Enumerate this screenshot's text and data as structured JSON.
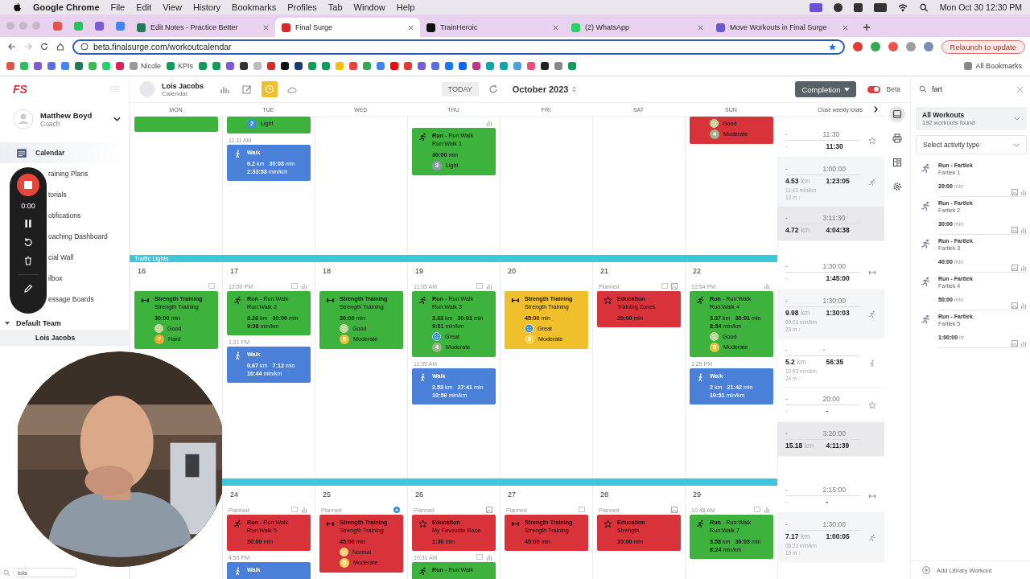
{
  "menubar": {
    "app": "Google Chrome",
    "items": [
      "File",
      "Edit",
      "View",
      "History",
      "Bookmarks",
      "Profiles",
      "Tab",
      "Window",
      "Help"
    ],
    "clock": "Mon Oct 30  12:30 PM"
  },
  "browser": {
    "pinned": [
      {
        "color": "#e0544b"
      },
      {
        "color": "#2dbe60"
      },
      {
        "color": "#7b5cd6"
      },
      {
        "color": "#4285f4"
      }
    ],
    "tabs": [
      {
        "title": "Edit Notes - Practice Better",
        "selected": false,
        "color": "#1f7a5a"
      },
      {
        "title": "Final Surge",
        "selected": true,
        "color": "#d62b2b"
      },
      {
        "title": "TrainHeroic",
        "selected": false,
        "color": "#111111"
      },
      {
        "title": "(2) WhatsApp",
        "selected": false,
        "color": "#25d366"
      },
      {
        "title": "Move Workouts in Final Surge",
        "selected": false,
        "color": "#6a5acd"
      }
    ],
    "url": "beta.finalsurge.com/workoutcalendar",
    "relaunch": "Relaunch to update",
    "bookmarks": [
      {
        "color": "#e0544b"
      },
      {
        "color": "#2dbe60"
      },
      {
        "color": "#7b5cd6"
      },
      {
        "color": "#5b6ee1"
      },
      {
        "color": "#4285f4"
      },
      {
        "color": "#1f7a5a"
      },
      {
        "color": "#3cba54"
      },
      {
        "color": "#25d366"
      },
      {
        "color": "#e01e5a"
      },
      {
        "label": "Nicole",
        "color": "#999999"
      },
      {
        "label": "KPIs",
        "color": "#0f9d58"
      },
      {
        "color": "#0f9d58"
      },
      {
        "color": "#0f9d58"
      },
      {
        "color": "#7b5cd6"
      },
      {
        "color": "#333333"
      },
      {
        "color": "#bbbbbb"
      },
      {
        "color": "#d62b2b"
      },
      {
        "color": "#111111"
      },
      {
        "color": "#1a3a7a"
      },
      {
        "color": "#0f9d58"
      },
      {
        "color": "#0f9d58"
      },
      {
        "color": "#fbbc05"
      },
      {
        "color": "#ea4335"
      },
      {
        "color": "#34a853"
      },
      {
        "color": "#4285f4"
      },
      {
        "color": "#ff0000"
      },
      {
        "color": "#e53935"
      },
      {
        "color": "#7b5cd6"
      },
      {
        "color": "#5b6ee1"
      },
      {
        "color": "#1877f2"
      },
      {
        "color": "#0866ff"
      },
      {
        "color": "#c13584"
      },
      {
        "color": "#0ea5a5"
      },
      {
        "color": "#0ea5a5"
      },
      {
        "color": "#4aa3df"
      },
      {
        "color": "#e94e77"
      },
      {
        "color": "#222222"
      },
      {
        "color": "#888888"
      },
      {
        "color": "#0f9d58"
      }
    ],
    "all_bookmarks": "All Bookmarks"
  },
  "sidebar": {
    "logo": "FS",
    "user": {
      "name": "Matthew Boyd",
      "role": "Coach"
    },
    "nav": [
      {
        "label": "Calendar",
        "selected": true,
        "kind": "calendar"
      },
      {
        "label": "raining Plans",
        "selected": false
      },
      {
        "label": "torials",
        "selected": false
      },
      {
        "label": "otifications",
        "selected": false
      },
      {
        "label": "oaching Dashboard",
        "selected": false
      },
      {
        "label": "cial Wall",
        "selected": false
      },
      {
        "label": "ilbox",
        "selected": false
      },
      {
        "label": "essage Boards",
        "selected": false
      }
    ],
    "team": {
      "name": "Default Team",
      "expanded": true
    },
    "athletes": [
      {
        "name": "Lois Jacobs",
        "selected": true
      }
    ],
    "search": {
      "value": "lois"
    }
  },
  "recorder": {
    "time": "0:00"
  },
  "toolbar": {
    "athlete": {
      "name": "Lois Jacobs",
      "sub": "Calendar"
    },
    "views": [
      {
        "kind": "chart",
        "selected": false
      },
      {
        "kind": "edit",
        "selected": false
      },
      {
        "kind": "clock",
        "selected": true
      },
      {
        "kind": "weather",
        "selected": false
      }
    ],
    "today": "TODAY",
    "month": "October 2023",
    "completion": "Completion",
    "beta": {
      "label": "Beta",
      "on": true
    }
  },
  "days": [
    "MON",
    "TUE",
    "WED",
    "THU",
    "FRI",
    "SAT",
    "SUN"
  ],
  "totals_toggle": "Close weekly totals",
  "weeks": [
    {
      "cells": [
        {
          "entries": [
            {
              "kind": "partial",
              "color": "#3db33d"
            }
          ]
        },
        {
          "entries": [
            {
              "kind": "partial",
              "color": "#3db33d",
              "effort": {
                "value": "2",
                "label": "Light",
                "color": "#3a8fd6"
              }
            },
            {
              "time": "11:11 AM",
              "kind": "walk",
              "color": "#4a80d8",
              "title": "Walk",
              "stats": [
                [
                  "**0.2** km",
                  "**30:03** min"
                ],
                [
                  "**2:33:53** min/km"
                ]
              ]
            }
          ]
        },
        {},
        {
          "entries": [
            {
              "chart": true,
              "kind": "run",
              "color": "#3db33d",
              "title": "**Run** - Run:Walk",
              "subtitle": "Run:Walk 1",
              "stats": [
                [
                  "**30:00** min"
                ]
              ],
              "effort": {
                "value": "3",
                "label": "Light",
                "color": "#8f9aa6"
              }
            }
          ]
        },
        {},
        {},
        {
          "entries": [
            {
              "kind": "partial",
              "color": "#d8323a",
              "feel": {
                "label": "Good",
                "color": "#b8d88a"
              },
              "effort": {
                "value": "4",
                "label": "Moderate",
                "color": "#9db38a"
              }
            }
          ]
        }
      ],
      "totals": [
        {
          "kind": "event",
          "planned": [
            "-",
            "11:30"
          ],
          "actual": [
            "-",
            "11:30"
          ]
        },
        {
          "kind": "run",
          "planned": [
            "-",
            "1:00:00"
          ],
          "actual": [
            "**4.53** km",
            "1:23:05"
          ],
          "pace": "11:43 min/km",
          "elev": "12 m ↑"
        },
        {
          "kind": "total",
          "planned": [
            "-",
            "3:11:30"
          ],
          "actual": [
            "**4.72** km",
            "4:04:38"
          ]
        }
      ]
    },
    {
      "label": "Traffic Lights",
      "cells": [
        {
          "date": "16",
          "entries": [
            {
              "note": true,
              "kind": "strength",
              "color": "#3db33d",
              "title": "Strength Training",
              "subtitle": "Strength Training",
              "stats": [
                [
                  "**30:00** min"
                ]
              ],
              "feel": {
                "label": "Good",
                "color": "#b8d88a"
              },
              "effort": {
                "value": "7",
                "label": "Hard",
                "color": "#f0a830"
              }
            }
          ]
        },
        {
          "date": "17",
          "entries": [
            {
              "time": "12:50 PM",
              "note": true,
              "chart": true,
              "kind": "run",
              "color": "#3db33d",
              "title": "**Run** - Run:Walk",
              "subtitle": "Run:Walk 2",
              "stats": [
                [
                  "**3.28** km",
                  "**30:00** min"
                ],
                [
                  "**9:08** min/km"
                ]
              ]
            },
            {
              "time": "1:21 PM",
              "kind": "walk",
              "color": "#4a80d8",
              "title": "Walk",
              "stats": [
                [
                  "**0.67** km",
                  "**7:12** min"
                ],
                [
                  "**10:44** min/km"
                ]
              ]
            }
          ]
        },
        {
          "date": "18",
          "entries": [
            {
              "kind": "strength",
              "color": "#3db33d",
              "title": "Strength Training",
              "subtitle": "Strength Training",
              "stats": [
                [
                  "**30:00** min"
                ]
              ],
              "feel": {
                "label": "Good",
                "color": "#b8d88a"
              },
              "effort": {
                "value": "5",
                "label": "Moderate",
                "color": "#e8c440"
              }
            }
          ]
        },
        {
          "date": "19",
          "entries": [
            {
              "time": "11:05 AM",
              "note": true,
              "chart": true,
              "kind": "run",
              "color": "#3db33d",
              "title": "**Run** - Run:Walk",
              "subtitle": "Run:Walk 3",
              "stats": [
                [
                  "**3.33** km",
                  "**30:01** min"
                ],
                [
                  "**9:01** min/km"
                ]
              ],
              "feel": {
                "label": "Great",
                "color": "#3a8fd6"
              },
              "effort": {
                "value": "4",
                "label": "Moderate",
                "color": "#9db38a"
              }
            },
            {
              "time": "11:35 AM",
              "kind": "walk",
              "color": "#4a80d8",
              "title": "Walk",
              "stats": [
                [
                  "**2.53** km",
                  "**27:41** min"
                ],
                [
                  "**10:56** min/km"
                ]
              ]
            }
          ]
        },
        {
          "date": "20",
          "entries": [
            {
              "kind": "strength",
              "color": "#efbf2c",
              "title": "Strength Training",
              "subtitle": "Strength Training",
              "stats": [
                [
                  "**45:00** min"
                ]
              ],
              "feel": {
                "label": "Great",
                "color": "#3a8fd6"
              },
              "effort": {
                "value": "5",
                "label": "Moderate",
                "color": "#f3d35a"
              }
            }
          ]
        },
        {
          "date": "21",
          "entries": [
            {
              "time": "Planned",
              "note": true,
              "image": true,
              "kind": "education",
              "color": "#d8323a",
              "title": "Education",
              "subtitle": "Training Zones",
              "stats": [
                [
                  "**20:00** min"
                ]
              ]
            }
          ]
        },
        {
          "date": "22",
          "entries": [
            {
              "time": "12:54 PM",
              "chart": true,
              "kind": "run",
              "color": "#3db33d",
              "title": "**Run** - Run:Walk",
              "subtitle": "Run:Walk 4",
              "stats": [
                [
                  "**3.37** km",
                  "**30:01** min"
                ],
                [
                  "**8:54** min/km"
                ]
              ],
              "feel": {
                "label": "Good",
                "color": "#b8d88a"
              },
              "effort": {
                "value": "5",
                "label": "Moderate",
                "color": "#e8c440"
              }
            },
            {
              "time": "1:25 PM",
              "kind": "walk",
              "color": "#4a80d8",
              "title": "Walk",
              "stats": [
                [
                  "**2** km",
                  "**21:42** min"
                ],
                [
                  "**10:51** min/km"
                ]
              ]
            }
          ]
        }
      ],
      "totals": [
        {
          "kind": "strength",
          "planned": [
            "-",
            "1:30:00"
          ],
          "actual": [
            "-",
            "1:45:00"
          ]
        },
        {
          "kind": "run",
          "planned": [
            "-",
            "1:30:00"
          ],
          "actual": [
            "**9.98** km",
            "1:30:03"
          ],
          "pace": "09:01 min/km",
          "elev": "23 m ↑"
        },
        {
          "kind": "walk",
          "planned": [
            "-",
            "-"
          ],
          "actual": [
            "**5.2** km",
            "56:35"
          ],
          "pace": "10:53 min/km",
          "elev": "24 m ↑"
        },
        {
          "kind": "event",
          "planned": [
            "-",
            "20:00"
          ],
          "actual": [
            "-",
            "-"
          ]
        },
        {
          "kind": "total",
          "planned": [
            "-",
            "3:20:00"
          ],
          "actual": [
            "**15.18** km",
            "4:11:39"
          ]
        }
      ]
    },
    {
      "cells": [
        {},
        {
          "date": "24",
          "entries": [
            {
              "time": "Planned",
              "note": true,
              "chart": true,
              "kind": "run",
              "color": "#d8323a",
              "title": "**Run** - Run:Walk",
              "subtitle": "Run:Walk 5",
              "stats": [
                [
                  "**30:00** min"
                ]
              ]
            },
            {
              "time": "4:55 PM",
              "kind": "walk",
              "color": "#4a80d8",
              "title": "Walk"
            }
          ]
        },
        {
          "date": "25",
          "entries": [
            {
              "time": "Planned",
              "upload": true,
              "kind": "strength",
              "color": "#d8323a",
              "title": "Strength Training",
              "subtitle": "Strength Training",
              "stats": [
                [
                  "**45:00** min"
                ]
              ],
              "feel": {
                "label": "Normal",
                "color": "#f3d35a"
              },
              "effort": {
                "value": "5",
                "label": "Moderate",
                "color": "#f3d35a"
              }
            }
          ]
        },
        {
          "date": "26",
          "entries": [
            {
              "time": "Planned",
              "image": true,
              "kind": "education",
              "color": "#d8323a",
              "title": "Education",
              "subtitle": "My Favourite Race",
              "stats": [
                [
                  "**1:30** min"
                ]
              ]
            },
            {
              "time": "10:31 AM",
              "note": true,
              "chart": true,
              "kind": "run",
              "color": "#3db33d",
              "title": "**Run** - Run:Walk"
            }
          ]
        },
        {
          "date": "27",
          "entries": [
            {
              "time": "Planned",
              "note": true,
              "kind": "strength",
              "color": "#d8323a",
              "title": "Strength Training",
              "subtitle": "Strength Training",
              "stats": [
                [
                  "**45:00** min"
                ]
              ]
            }
          ]
        },
        {
          "date": "28",
          "entries": [
            {
              "time": "Planned",
              "image": true,
              "kind": "education",
              "color": "#d8323a",
              "title": "Education",
              "subtitle": "Strength",
              "stats": [
                [
                  "**10:00** min"
                ]
              ]
            }
          ]
        },
        {
          "date": "29",
          "entries": [
            {
              "time": "10:48 AM",
              "note": true,
              "chart": true,
              "kind": "run",
              "color": "#3db33d",
              "title": "**Run** - Run:Walk",
              "subtitle": "Run:Walk 7",
              "stats": [
                [
                  "**3.58** km",
                  "**30:03** min"
                ],
                [
                  "**8:24** min/km"
                ]
              ]
            }
          ]
        }
      ],
      "totals": [
        {
          "kind": "strength",
          "planned": [
            "-",
            "2:15:00"
          ],
          "actual": [
            "-",
            "-"
          ]
        },
        {
          "kind": "run",
          "planned": [
            "-",
            "1:30:00"
          ],
          "actual": [
            "**7.17** km",
            "1:00:05"
          ],
          "pace": "08:22 min/km",
          "elev": "19 m ↑"
        }
      ]
    }
  ],
  "side_tools": [
    {
      "kind": "panel",
      "selected": true
    },
    {
      "kind": "print",
      "selected": false
    },
    {
      "kind": "columns",
      "selected": false
    },
    {
      "kind": "settings",
      "selected": false
    }
  ],
  "library": {
    "search": {
      "value": "fart"
    },
    "filter": {
      "title": "All Workouts",
      "count": "192 workouts found"
    },
    "activity": {
      "placeholder": "Select activity type"
    },
    "items": [
      {
        "title": "Run - Fartlek",
        "name": "Fartlek 1",
        "duration": "**20:00** min"
      },
      {
        "title": "Run - Fartlek",
        "name": "Fartlek 2",
        "duration": "**30:00** min"
      },
      {
        "title": "Run - Fartlek",
        "name": "Fartlek 3",
        "duration": "**40:00** min"
      },
      {
        "title": "Run - Fartlek",
        "name": "Fartlek 4",
        "duration": "**50:00** min"
      },
      {
        "title": "Run - Fartlek",
        "name": "Fartlek 5",
        "duration": "**1:00:00** hr"
      }
    ],
    "add": "Add Library Workout"
  }
}
